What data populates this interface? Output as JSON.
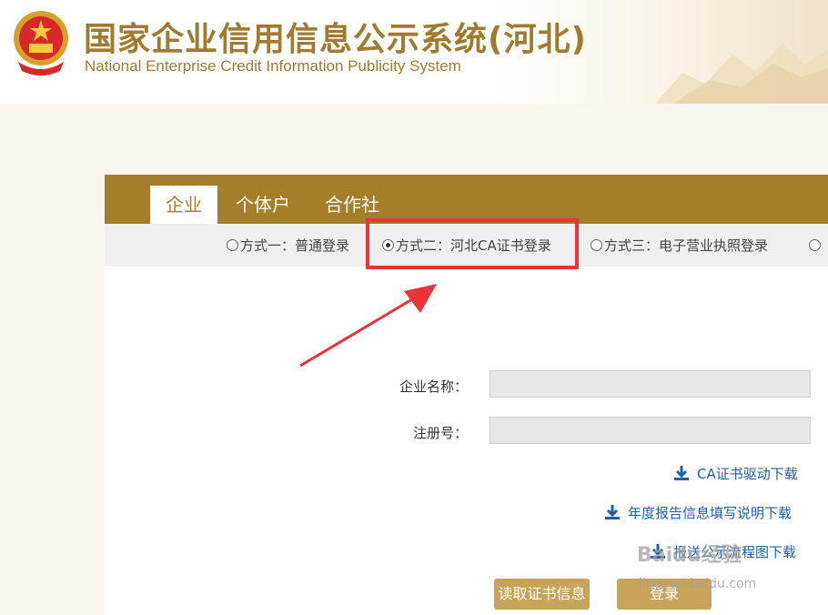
{
  "header": {
    "title": "国家企业信用信息公示系统(河北)",
    "subtitle": "National Enterprise Credit Information Publicity System"
  },
  "tabs": [
    {
      "label": "企业",
      "active": true
    },
    {
      "label": "个体户",
      "active": false
    },
    {
      "label": "合作社",
      "active": false
    }
  ],
  "login_methods": [
    {
      "label": "方式一：普通登录",
      "selected": false
    },
    {
      "label": "方式二：河北CA证书登录",
      "selected": true
    },
    {
      "label": "方式三：电子营业执照登录",
      "selected": false
    }
  ],
  "form": {
    "company_name_label": "企业名称：",
    "company_name_value": "",
    "reg_no_label": "注册号：",
    "reg_no_value": ""
  },
  "downloads": [
    {
      "label": "CA证书驱动下载"
    },
    {
      "label": "年度报告信息填写说明下载"
    },
    {
      "label": "报送公示流程图下载"
    }
  ],
  "buttons": {
    "read_cert": "读取证书信息",
    "login": "登录"
  },
  "watermark": {
    "brand": "Baidu经验",
    "url": "jingyan.baidu.com"
  },
  "colors": {
    "brand_gold": "#a57e2c",
    "highlight_red": "#e8333a",
    "link_blue": "#1f5fa8"
  }
}
